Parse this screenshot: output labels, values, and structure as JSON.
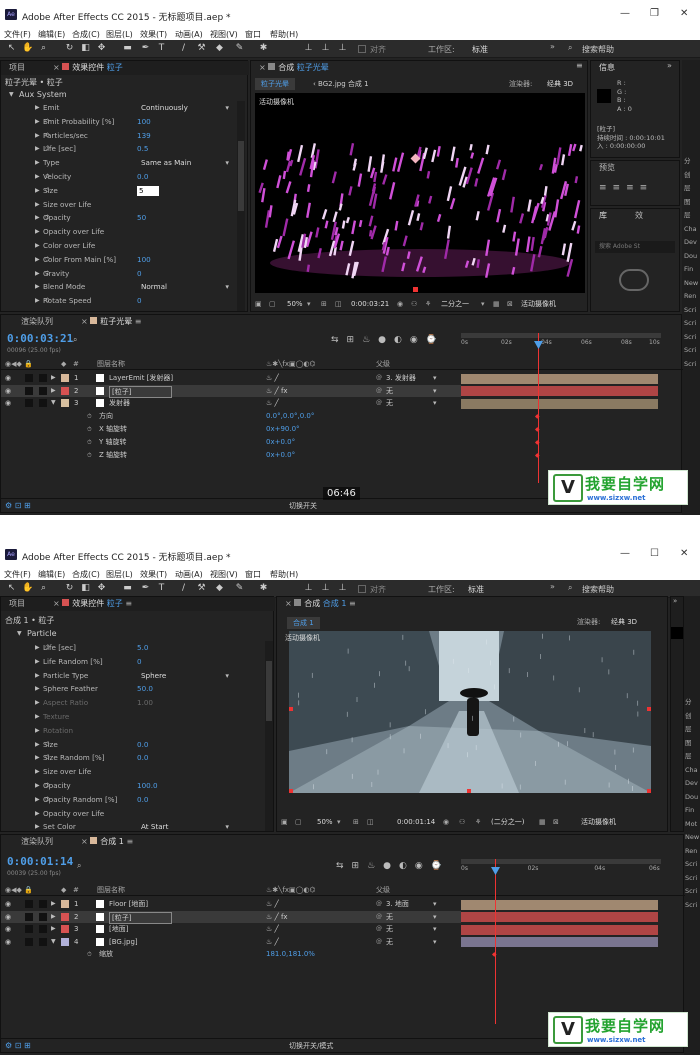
{
  "shot1": {
    "title": "Adobe After Effects CC 2015 - 无标题项目.aep *",
    "menu": [
      "文件(F)",
      "编辑(E)",
      "合成(C)",
      "图层(L)",
      "效果(T)",
      "动画(A)",
      "视图(V)",
      "窗口",
      "帮助(H)"
    ],
    "toolbar": {
      "align_label": "对齐",
      "workspace_label": "工作区:",
      "workspace_value": "标准",
      "search_help": "搜索帮助"
    },
    "project_tab": "项目",
    "effects_tab": {
      "prefix": "效果控件",
      "name": "粒子"
    },
    "effects_path": "粒子光晕 • 粒子",
    "effects_group": "Aux System",
    "effects_rows": [
      {
        "label": "Emit",
        "type": "dropdown",
        "value": "Continuously"
      },
      {
        "label": "Emit Probability [%]",
        "value": "100",
        "stop": true
      },
      {
        "label": "Particles/sec",
        "value": "139",
        "stop": true
      },
      {
        "label": "Life [sec]",
        "value": "0.5",
        "stop": true
      },
      {
        "label": "Type",
        "type": "dropdown",
        "value": "Same as Main"
      },
      {
        "label": "Velocity",
        "value": "0.0",
        "stop": true
      },
      {
        "label": "Size",
        "value": "5",
        "stop": true,
        "editing": true
      },
      {
        "label": "Size over Life",
        "value": ""
      },
      {
        "label": "Opacity",
        "value": "50",
        "stop": true
      },
      {
        "label": "Opacity over Life",
        "value": ""
      },
      {
        "label": "Color over Life",
        "value": ""
      },
      {
        "label": "Color From Main [%]",
        "value": "100",
        "stop": true
      },
      {
        "label": "Gravity",
        "value": "0",
        "stop": true
      },
      {
        "label": "Blend Mode",
        "type": "dropdown",
        "value": "Normal"
      },
      {
        "label": "Rotate Speed",
        "value": "0",
        "stop": true
      }
    ],
    "viewer": {
      "comp_tab_prefix": "合成",
      "comp_tab_name": "粒子光晕",
      "sub_tab_active": "粒子光晕",
      "sub_tab_2": "BG2.jpg 合成 1",
      "renderer_label": "渲染器:",
      "renderer_value": "经典 3D",
      "camera_label": "活动摄像机",
      "zoom": "50%",
      "timecode": "0:00:03:21",
      "resolution": "二分之一",
      "view": "活动摄像机"
    },
    "info_panel": {
      "title": "信息",
      "r": "R :",
      "g": "G :",
      "b": "B :",
      "a": "A : 0",
      "layer": "[粒子]",
      "dur": "持续时间 : 0:00:10:01",
      "in": "入 : 0:00:00:00"
    },
    "preview_tab": "预览",
    "lib_tab": "库",
    "lib_tab2": "效",
    "lib_search": "搜索 Adobe St",
    "right_sliver": [
      "分",
      "创",
      "层",
      "图",
      "层",
      "Cha",
      "Dev",
      "Dou",
      "Fin",
      "New",
      "Ren",
      "Scri",
      "Scri",
      "Scri",
      "Scri",
      "Scri"
    ],
    "timeline": {
      "render_tab": "渲染队列",
      "comp_tab": "粒子光晕",
      "time": "0:00:03:21",
      "frames": "00096 (25.00 fps)",
      "col_layer_name": "图层名称",
      "col_parent": "父级",
      "ruler": [
        "0s",
        "02s",
        "04s",
        "06s",
        "08s",
        "10s"
      ],
      "layers": [
        {
          "num": "1",
          "name": "LayerEmit [发射器]",
          "chip": "#d8b89a",
          "parent": "3. 发射器",
          "bar_color": "#a08870"
        },
        {
          "num": "2",
          "name": "[粒子]",
          "chip": "#d65252",
          "parent": "无",
          "bar_color": "#b04545",
          "selected": true
        },
        {
          "num": "3",
          "name": "发射器",
          "chip": "#d8c0a0",
          "parent": "无",
          "bar_color": "#8a7a62",
          "open": true
        }
      ],
      "sub_props": [
        {
          "name": "方向",
          "value": "0.0°,0.0°,0.0°"
        },
        {
          "name": "X 轴旋转",
          "value": "0x+90.0°"
        },
        {
          "name": "Y 轴旋转",
          "value": "0x+0.0°"
        },
        {
          "name": "Z 轴旋转",
          "value": "0x+0.0°"
        }
      ],
      "footer": "切换开关",
      "video_time": "06:46"
    },
    "watermark": {
      "cn": "我要自学网",
      "url": "www.sizxw.net"
    }
  },
  "shot2": {
    "title": "Adobe After Effects CC 2015 - 无标题项目.aep *",
    "menu": [
      "文件(F)",
      "编辑(E)",
      "合成(C)",
      "图层(L)",
      "效果(T)",
      "动画(A)",
      "视图(V)",
      "窗口",
      "帮助(H)"
    ],
    "toolbar": {
      "align_label": "对齐",
      "workspace_label": "工作区:",
      "workspace_value": "标准",
      "search_help": "搜索帮助"
    },
    "project_tab": "项目",
    "effects_tab": {
      "prefix": "效果控件",
      "name": "粒子"
    },
    "effects_path": "合成 1 • 粒子",
    "effects_group": "Particle",
    "effects_rows": [
      {
        "label": "Life [sec]",
        "value": "5.0",
        "stop": true
      },
      {
        "label": "Life Random [%]",
        "value": "0"
      },
      {
        "label": "Particle Type",
        "type": "dropdown",
        "value": "Sphere"
      },
      {
        "label": "Sphere Feather",
        "value": "50.0"
      },
      {
        "label": "Aspect Ratio",
        "value": "1.00",
        "dim": true
      },
      {
        "label": "Texture",
        "value": "",
        "dim": true
      },
      {
        "label": "Rotation",
        "value": "",
        "dim": true
      },
      {
        "label": "Size",
        "value": "0.0",
        "stop": true
      },
      {
        "label": "Size Random [%]",
        "value": "0.0",
        "stop": true
      },
      {
        "label": "Size over Life",
        "value": ""
      },
      {
        "label": "Opacity",
        "value": "100.0",
        "stop": true
      },
      {
        "label": "Opacity Random [%]",
        "value": "0.0",
        "stop": true
      },
      {
        "label": "Opacity over Life",
        "value": ""
      },
      {
        "label": "Set Color",
        "type": "dropdown",
        "value": "At Start"
      }
    ],
    "viewer": {
      "comp_tab_prefix": "合成",
      "comp_tab_name": "合成 1",
      "sub_tab_active": "合成 1",
      "renderer_label": "渲染器:",
      "renderer_value": "经典 3D",
      "camera_label": "活动摄像机",
      "zoom": "50%",
      "timecode": "0:00:01:14",
      "resolution": "(二分之一)",
      "view": "活动摄像机"
    },
    "right_sliver": [
      "分",
      "创",
      "层",
      "图",
      "层",
      "Cha",
      "Dev",
      "Dou",
      "Fin",
      "Mot",
      "New",
      "Ren",
      "Scri",
      "Scri",
      "Scri",
      "Scri"
    ],
    "timeline": {
      "render_tab": "渲染队列",
      "comp_tab": "合成 1",
      "time": "0:00:01:14",
      "frames": "00039 (25.00 fps)",
      "col_layer_name": "图层名称",
      "col_parent": "父级",
      "ruler": [
        "0s",
        "02s",
        "04s",
        "06s"
      ],
      "layers": [
        {
          "num": "1",
          "name": "Floor [地面]",
          "chip": "#d8b89a",
          "parent": "3. 地面",
          "bar_color": "#a08870"
        },
        {
          "num": "2",
          "name": "[粒子]",
          "chip": "#d65252",
          "parent": "无",
          "bar_color": "#b04545",
          "selected": true
        },
        {
          "num": "3",
          "name": "[地面]",
          "chip": "#d65252",
          "parent": "无",
          "bar_color": "#b04545"
        },
        {
          "num": "4",
          "name": "[BG.jpg]",
          "chip": "#b0b0d8",
          "parent": "无",
          "bar_color": "#7a7590",
          "open": true
        }
      ],
      "sub_props": [
        {
          "name": "缩放",
          "value": "181.0,181.0%"
        }
      ],
      "footer": "切换开关/模式"
    },
    "watermark": {
      "cn": "我要自学网",
      "url": "www.sizxw.net"
    }
  }
}
